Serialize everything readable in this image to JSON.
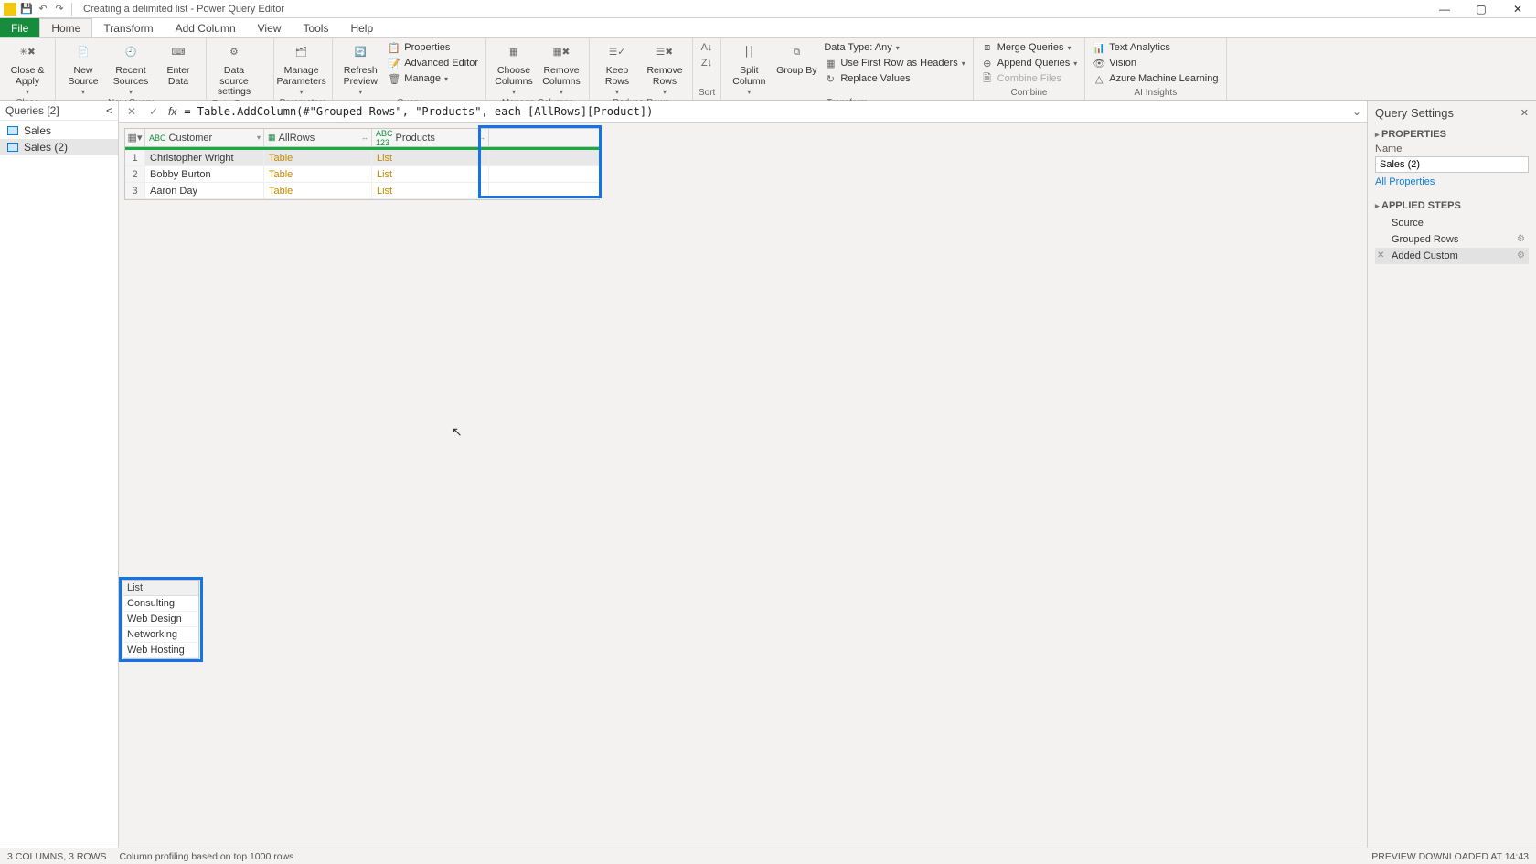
{
  "titlebar": {
    "title": "Creating a delimited list - Power Query Editor"
  },
  "tabs": {
    "file": "File",
    "home": "Home",
    "transform": "Transform",
    "addcolumn": "Add Column",
    "view": "View",
    "tools": "Tools",
    "help": "Help"
  },
  "ribbon": {
    "close": {
      "closeApply": "Close &\nApply",
      "group": "Close"
    },
    "newquery": {
      "newSource": "New\nSource",
      "recentSources": "Recent\nSources",
      "enterData": "Enter\nData",
      "group": "New Query"
    },
    "datasources": {
      "dsSettings": "Data source\nsettings",
      "group": "Data Sources"
    },
    "parameters": {
      "manageParams": "Manage\nParameters",
      "group": "Parameters"
    },
    "query": {
      "refresh": "Refresh\nPreview",
      "properties": "Properties",
      "advEditor": "Advanced Editor",
      "manage": "Manage",
      "group": "Query"
    },
    "managecols": {
      "choose": "Choose\nColumns",
      "remove": "Remove\nColumns",
      "group": "Manage Columns"
    },
    "reducerows": {
      "keep": "Keep\nRows",
      "removeR": "Remove\nRows",
      "group": "Reduce Rows"
    },
    "sort": {
      "group": "Sort"
    },
    "transform": {
      "split": "Split\nColumn",
      "groupBy": "Group\nBy",
      "dataType": "Data Type: Any",
      "firstRow": "Use First Row as Headers",
      "replace": "Replace Values",
      "group": "Transform"
    },
    "combine": {
      "merge": "Merge Queries",
      "append": "Append Queries",
      "combineFiles": "Combine Files",
      "group": "Combine"
    },
    "ai": {
      "textAnalytics": "Text Analytics",
      "vision": "Vision",
      "azureML": "Azure Machine Learning",
      "group": "AI Insights"
    }
  },
  "queriesPane": {
    "title": "Queries [2]",
    "items": [
      {
        "name": "Sales"
      },
      {
        "name": "Sales (2)"
      }
    ]
  },
  "formula": {
    "text": "= Table.AddColumn(#\"Grouped Rows\", \"Products\", each [AllRows][Product])"
  },
  "grid": {
    "columns": {
      "customer": "Customer",
      "allrows": "AllRows",
      "products": "Products"
    },
    "rows": [
      {
        "n": "1",
        "customer": "Christopher Wright",
        "allrows": "Table",
        "products": "List"
      },
      {
        "n": "2",
        "customer": "Bobby Burton",
        "allrows": "Table",
        "products": "List"
      },
      {
        "n": "3",
        "customer": "Aaron Day",
        "allrows": "Table",
        "products": "List"
      }
    ]
  },
  "preview": {
    "header": "List",
    "rows": [
      "Consulting",
      "Web Design",
      "Networking",
      "Web Hosting"
    ]
  },
  "settings": {
    "title": "Query Settings",
    "properties": "PROPERTIES",
    "nameLabel": "Name",
    "nameValue": "Sales (2)",
    "allProps": "All Properties",
    "appliedSteps": "APPLIED STEPS",
    "steps": [
      {
        "name": "Source"
      },
      {
        "name": "Grouped Rows",
        "gear": true
      },
      {
        "name": "Added Custom",
        "gear": true,
        "sel": true
      }
    ]
  },
  "status": {
    "cols": "3 COLUMNS, 3 ROWS",
    "profiling": "Column profiling based on top 1000 rows",
    "right": "PREVIEW DOWNLOADED AT 14:43"
  }
}
